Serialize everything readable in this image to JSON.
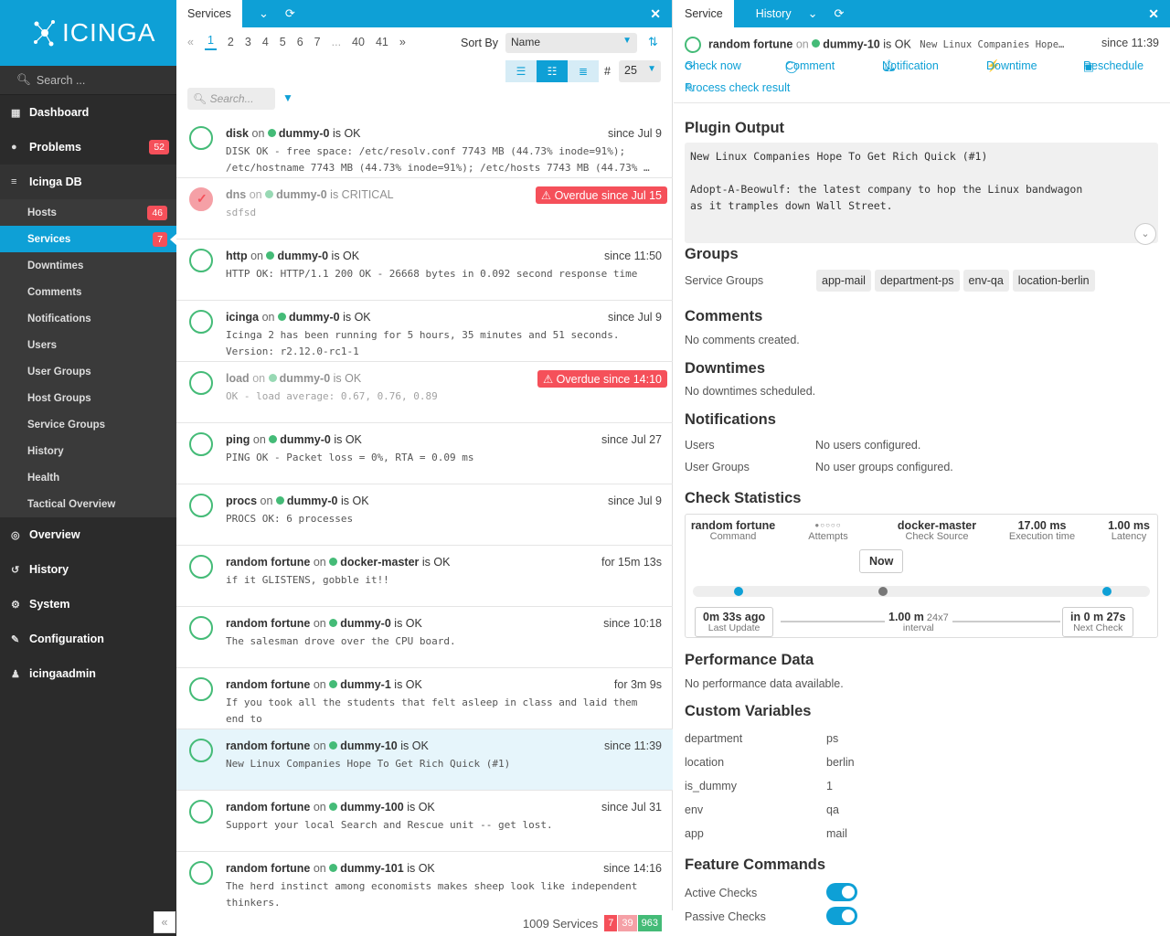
{
  "sidebar": {
    "brand": "ICINGA",
    "search_placeholder": "Search ...",
    "items": [
      {
        "label": "Dashboard",
        "icon": "dashboard-icon"
      },
      {
        "label": "Problems",
        "icon": "problems-icon",
        "badge": "52"
      },
      {
        "label": "Icinga DB",
        "icon": "database-icon"
      },
      {
        "label": "Overview",
        "icon": "binoculars-icon"
      },
      {
        "label": "History",
        "icon": "history-icon"
      },
      {
        "label": "System",
        "icon": "gears-icon"
      },
      {
        "label": "Configuration",
        "icon": "wrench-icon"
      },
      {
        "label": "icingaadmin",
        "icon": "user-icon"
      }
    ],
    "sub": [
      {
        "label": "Hosts",
        "badge": "46"
      },
      {
        "label": "Services",
        "badge": "7"
      },
      {
        "label": "Downtimes"
      },
      {
        "label": "Comments"
      },
      {
        "label": "Notifications"
      },
      {
        "label": "Users"
      },
      {
        "label": "User Groups"
      },
      {
        "label": "Host Groups"
      },
      {
        "label": "Service Groups"
      },
      {
        "label": "History"
      },
      {
        "label": "Health"
      },
      {
        "label": "Tactical Overview"
      }
    ]
  },
  "list": {
    "tab": "Services",
    "pages": [
      "«",
      "1",
      "2",
      "3",
      "4",
      "5",
      "6",
      "7",
      "...",
      "40",
      "41",
      "»"
    ],
    "sort_label": "Sort By",
    "sort_value": "Name",
    "limit_label": "#",
    "limit_value": "25",
    "filter_placeholder": "Search...",
    "rows": [
      {
        "service": "disk",
        "host": "dummy-0",
        "state": "OK",
        "since": "since Jul 9",
        "output": "DISK OK - free space: /etc/resolv.conf 7743 MB (44.73% inode=91%);\n/etc/hostname 7743 MB (44.73% inode=91%); /etc/hosts 7743 MB (44.73% …"
      },
      {
        "service": "dns",
        "host": "dummy-0",
        "state": "CRITICAL",
        "overdue": "Overdue since Jul 15",
        "output": "sdfsd",
        "dim": true,
        "crit": true
      },
      {
        "service": "http",
        "host": "dummy-0",
        "state": "OK",
        "since": "since 11:50",
        "output": "HTTP OK: HTTP/1.1 200 OK - 26668 bytes in 0.092 second response time"
      },
      {
        "service": "icinga",
        "host": "dummy-0",
        "state": "OK",
        "since": "since Jul 9",
        "output": "Icinga 2 has been running for 5 hours, 35 minutes and 51 seconds.\nVersion: r2.12.0-rc1-1"
      },
      {
        "service": "load",
        "host": "dummy-0",
        "state": "OK",
        "overdue": "Overdue since 14:10",
        "output": "OK - load average: 0.67, 0.76, 0.89",
        "dim": true
      },
      {
        "service": "ping",
        "host": "dummy-0",
        "state": "OK",
        "since": "since Jul 27",
        "output": "PING OK - Packet loss = 0%, RTA = 0.09 ms"
      },
      {
        "service": "procs",
        "host": "dummy-0",
        "state": "OK",
        "since": "since Jul 9",
        "output": "PROCS OK: 6 processes"
      },
      {
        "service": "random fortune",
        "host": "docker-master",
        "state": "OK",
        "since": "for 15m 13s",
        "output": "if it GLISTENS, gobble it!!"
      },
      {
        "service": "random fortune",
        "host": "dummy-0",
        "state": "OK",
        "since": "since 10:18",
        "output": "The salesman drove over the CPU board."
      },
      {
        "service": "random fortune",
        "host": "dummy-1",
        "state": "OK",
        "since": "for 3m 9s",
        "output": "If you took all the students that felt asleep in class and laid them\nend to"
      },
      {
        "service": "random fortune",
        "host": "dummy-10",
        "state": "OK",
        "since": "since 11:39",
        "output": "New Linux Companies Hope To Get Rich Quick (#1)",
        "selected": true
      },
      {
        "service": "random fortune",
        "host": "dummy-100",
        "state": "OK",
        "since": "since Jul 31",
        "output": "Support your local Search and Rescue unit -- get lost."
      },
      {
        "service": "random fortune",
        "host": "dummy-101",
        "state": "OK",
        "since": "since 14:16",
        "output": "The herd instinct among economists makes sheep look like independent\nthinkers."
      }
    ],
    "footer": {
      "count": "1009 Services",
      "crit": "7",
      "crit_soft": "39",
      "ok": "963"
    }
  },
  "detail": {
    "tabs": [
      "Service",
      "History"
    ],
    "title": {
      "service": "random fortune",
      "on": "on",
      "host": "dummy-10",
      "is": "is OK",
      "output": "New Linux Companies Hope…",
      "since": "since 11:39"
    },
    "actions": [
      "Check now",
      "Comment",
      "Notification",
      "Downtime",
      "Reschedule",
      "Process check result"
    ],
    "plugin_output_title": "Plugin Output",
    "plugin_output": "New Linux Companies Hope To Get Rich Quick (#1)\n\nAdopt-A-Beowulf: the latest company to hop the Linux bandwagon\nas it tramples down Wall Street.",
    "groups_title": "Groups",
    "service_groups_label": "Service Groups",
    "service_groups": [
      "app-mail",
      "department-ps",
      "env-qa",
      "location-berlin"
    ],
    "comments_title": "Comments",
    "comments_empty": "No comments created.",
    "downtimes_title": "Downtimes",
    "downtimes_empty": "No downtimes scheduled.",
    "notifications_title": "Notifications",
    "users_label": "Users",
    "users_value": "No users configured.",
    "usergroups_label": "User Groups",
    "usergroups_value": "No user groups configured.",
    "check_stats_title": "Check Statistics",
    "stats": {
      "command": "random fortune",
      "command_label": "Command",
      "attempts": "●○○○○",
      "attempts_label": "Attempts",
      "source": "docker-master",
      "source_label": "Check Source",
      "exec": "17.00 ms",
      "exec_label": "Execution time",
      "latency": "1.00 ms",
      "latency_label": "Latency",
      "now": "Now",
      "last": "0m 33s ago",
      "last_label": "Last Update",
      "interval": "1.00 m",
      "interval_extra": "24x7",
      "interval_label": "interval",
      "next": "in 0 m 27s",
      "next_label": "Next Check"
    },
    "perf_title": "Performance Data",
    "perf_empty": "No performance data available.",
    "custom_title": "Custom Variables",
    "custom_vars": [
      {
        "k": "department",
        "v": "ps"
      },
      {
        "k": "location",
        "v": "berlin"
      },
      {
        "k": "is_dummy",
        "v": "1"
      },
      {
        "k": "env",
        "v": "qa"
      },
      {
        "k": "app",
        "v": "mail"
      }
    ],
    "feature_title": "Feature Commands",
    "features": [
      {
        "label": "Active Checks",
        "enabled": true
      },
      {
        "label": "Passive Checks",
        "enabled": true
      }
    ]
  }
}
